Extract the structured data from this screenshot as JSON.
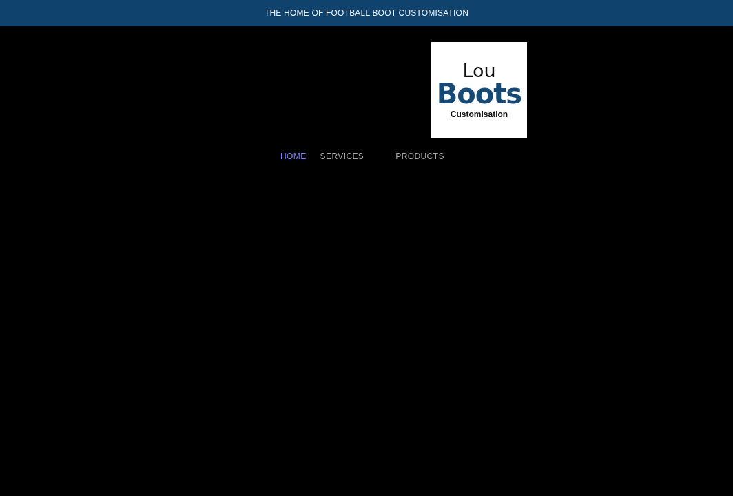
{
  "banner": {
    "text": "THE HOME OF FOOTBALL BOOT CUSTOMISATION"
  },
  "logo": {
    "line_1": "Lou",
    "line_2": "Boots",
    "line_3": "Customisation"
  },
  "nav": [
    {
      "label": "HOME",
      "selected": true
    },
    {
      "label": "SERVICES",
      "selected": false
    },
    {
      "label": "PRODUCTS",
      "selected": false
    }
  ]
}
